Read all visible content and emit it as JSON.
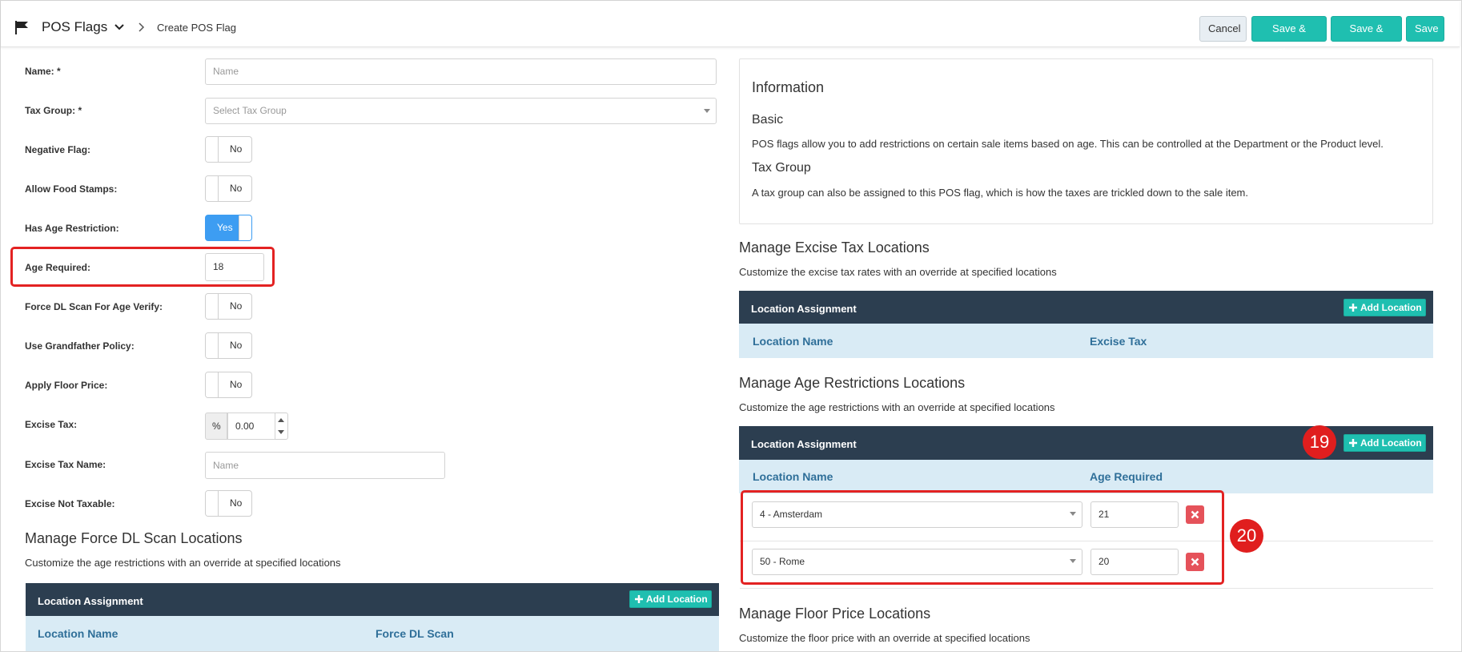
{
  "header": {
    "title": "POS Flags",
    "breadcrumb": "Create POS Flag",
    "buttons": {
      "cancel": "Cancel",
      "save_close": "Save & Close",
      "save_new": "Save & New",
      "save": "Save"
    }
  },
  "form": {
    "name": {
      "label": "Name: *",
      "placeholder": "Name"
    },
    "tax_group": {
      "label": "Tax Group: *",
      "placeholder": "Select Tax Group"
    },
    "negative_flag": {
      "label": "Negative Flag:",
      "value": "No"
    },
    "allow_food_stamps": {
      "label": "Allow Food Stamps:",
      "value": "No"
    },
    "has_age_restriction": {
      "label": "Has Age Restriction:",
      "value": "Yes"
    },
    "age_required": {
      "label": "Age Required:",
      "value": "18"
    },
    "force_dl_scan": {
      "label": "Force DL Scan For Age Verify:",
      "value": "No"
    },
    "grandfather": {
      "label": "Use Grandfather Policy:",
      "value": "No"
    },
    "floor_price": {
      "label": "Apply Floor Price:",
      "value": "No"
    },
    "excise_tax": {
      "label": "Excise Tax:",
      "prefix": "%",
      "value": "0.00"
    },
    "excise_tax_name": {
      "label": "Excise Tax Name:",
      "placeholder": "Name"
    },
    "excise_not_taxable": {
      "label": "Excise Not Taxable:",
      "value": "No"
    }
  },
  "force_dl_section": {
    "title": "Manage Force DL Scan Locations",
    "subtitle": "Customize the age restrictions with an override at specified locations",
    "panel_title": "Location Assignment",
    "add_label": "Add Location",
    "col1": "Location Name",
    "col2": "Force DL Scan"
  },
  "information": {
    "title": "Information",
    "basic_heading": "Basic",
    "basic_text": "POS flags allow you to add restrictions on certain sale items based on age. This can be controlled at the Department or the Product level.",
    "tax_heading": "Tax Group",
    "tax_text": "A tax group can also be assigned to this POS flag, which is how the taxes are trickled down to the sale item."
  },
  "excise_section": {
    "title": "Manage Excise Tax Locations",
    "subtitle": "Customize the excise tax rates with an override at specified locations",
    "panel_title": "Location Assignment",
    "add_label": "Add Location",
    "col1": "Location Name",
    "col2": "Excise Tax"
  },
  "age_section": {
    "title": "Manage Age Restrictions Locations",
    "subtitle": "Customize the age restrictions with an override at specified locations",
    "panel_title": "Location Assignment",
    "add_label": "Add Location",
    "col1": "Location Name",
    "col2": "Age Required",
    "rows": [
      {
        "location": "4 - Amsterdam",
        "age": "21"
      },
      {
        "location": "50 - Rome",
        "age": "20"
      }
    ]
  },
  "floor_section": {
    "title": "Manage Floor Price Locations",
    "subtitle": "Customize the floor price with an override at specified locations"
  },
  "annotations": {
    "badge_add": "19",
    "badge_rows": "20"
  },
  "colors": {
    "teal": "#1fbfb0",
    "navy": "#2c3e50",
    "toggle_on": "#3d9df2",
    "highlight": "#e32222"
  }
}
